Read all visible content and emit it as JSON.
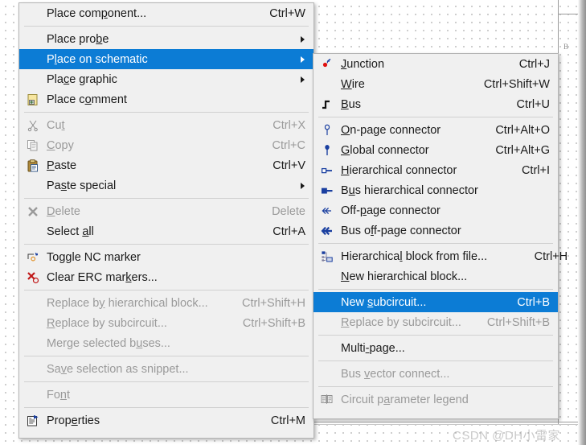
{
  "canvas": {
    "sheet_letter": "B",
    "watermark": "CSDN @DH小雷家"
  },
  "main_menu": {
    "items": [
      {
        "id": "place-component",
        "label": "Place component...",
        "accel": "Ctrl+W",
        "icon": null,
        "arrow": false,
        "disabled": false,
        "selected": false
      },
      {
        "id": "sep1",
        "separator": true
      },
      {
        "id": "place-probe",
        "label": "Place probe",
        "accel": "",
        "icon": null,
        "arrow": true,
        "disabled": false,
        "selected": false
      },
      {
        "id": "place-on-schematic",
        "label": "Place on schematic",
        "accel": "",
        "icon": null,
        "arrow": true,
        "disabled": false,
        "selected": true
      },
      {
        "id": "place-graphic",
        "label": "Place graphic",
        "accel": "",
        "icon": null,
        "arrow": true,
        "disabled": false,
        "selected": false
      },
      {
        "id": "place-comment",
        "label": "Place comment",
        "accel": "",
        "icon": "comment-icon",
        "arrow": false,
        "disabled": false,
        "selected": false
      },
      {
        "id": "sep2",
        "separator": true
      },
      {
        "id": "cut",
        "label": "Cut",
        "accel": "Ctrl+X",
        "icon": "scissors-icon",
        "arrow": false,
        "disabled": true,
        "selected": false
      },
      {
        "id": "copy",
        "label": "Copy",
        "accel": "Ctrl+C",
        "icon": "copy-icon",
        "arrow": false,
        "disabled": true,
        "selected": false
      },
      {
        "id": "paste",
        "label": "Paste",
        "accel": "Ctrl+V",
        "icon": "clipboard-icon",
        "arrow": false,
        "disabled": false,
        "selected": false
      },
      {
        "id": "paste-special",
        "label": "Paste special",
        "accel": "",
        "icon": null,
        "arrow": true,
        "disabled": false,
        "selected": false
      },
      {
        "id": "sep3",
        "separator": true
      },
      {
        "id": "delete",
        "label": "Delete",
        "accel": "Delete",
        "icon": "x-icon",
        "arrow": false,
        "disabled": true,
        "selected": false
      },
      {
        "id": "select-all",
        "label": "Select all",
        "accel": "Ctrl+A",
        "icon": null,
        "arrow": false,
        "disabled": false,
        "selected": false
      },
      {
        "id": "sep4",
        "separator": true
      },
      {
        "id": "toggle-nc-marker",
        "label": "Toggle NC marker",
        "accel": "",
        "icon": "nc-marker-icon",
        "arrow": false,
        "disabled": false,
        "selected": false
      },
      {
        "id": "clear-erc-markers",
        "label": "Clear ERC markers...",
        "accel": "",
        "icon": "erc-marker-icon",
        "arrow": false,
        "disabled": false,
        "selected": false
      },
      {
        "id": "sep5",
        "separator": true
      },
      {
        "id": "replace-by-hierarchical-block",
        "label": "Replace by hierarchical block...",
        "accel": "Ctrl+Shift+H",
        "icon": null,
        "arrow": false,
        "disabled": true,
        "selected": false
      },
      {
        "id": "replace-by-subcircuit",
        "label": "Replace by subcircuit...",
        "accel": "Ctrl+Shift+B",
        "icon": null,
        "arrow": false,
        "disabled": true,
        "selected": false
      },
      {
        "id": "merge-selected-buses",
        "label": "Merge selected buses...",
        "accel": "",
        "icon": null,
        "arrow": false,
        "disabled": true,
        "selected": false
      },
      {
        "id": "sep6",
        "separator": true
      },
      {
        "id": "save-selection-as-snippet",
        "label": "Save selection as snippet...",
        "accel": "",
        "icon": null,
        "arrow": false,
        "disabled": true,
        "selected": false
      },
      {
        "id": "sep7",
        "separator": true
      },
      {
        "id": "font",
        "label": "Font",
        "accel": "",
        "icon": null,
        "arrow": false,
        "disabled": true,
        "selected": false
      },
      {
        "id": "sep8",
        "separator": true
      },
      {
        "id": "properties",
        "label": "Properties",
        "accel": "Ctrl+M",
        "icon": "properties-icon",
        "arrow": false,
        "disabled": false,
        "selected": false
      }
    ]
  },
  "sub_menu": {
    "items": [
      {
        "id": "junction",
        "label": "Junction",
        "accel": "Ctrl+J",
        "icon": "junction-icon",
        "disabled": false,
        "selected": false
      },
      {
        "id": "wire",
        "label": "Wire",
        "accel": "Ctrl+Shift+W",
        "icon": null,
        "disabled": false,
        "selected": false
      },
      {
        "id": "bus",
        "label": "Bus",
        "accel": "Ctrl+U",
        "icon": "bus-icon",
        "disabled": false,
        "selected": false
      },
      {
        "id": "sep1",
        "separator": true
      },
      {
        "id": "on-page-connector",
        "label": "On-page connector",
        "accel": "Ctrl+Alt+O",
        "icon": "on-page-connector-icon",
        "disabled": false,
        "selected": false
      },
      {
        "id": "global-connector",
        "label": "Global connector",
        "accel": "Ctrl+Alt+G",
        "icon": "global-connector-icon",
        "disabled": false,
        "selected": false
      },
      {
        "id": "hierarchical-connector",
        "label": "Hierarchical connector",
        "accel": "Ctrl+I",
        "icon": "hierarchical-connector-icon",
        "disabled": false,
        "selected": false
      },
      {
        "id": "bus-hierarchical-connector",
        "label": "Bus hierarchical connector",
        "accel": "",
        "icon": "bus-hierarchical-connector-icon",
        "disabled": false,
        "selected": false
      },
      {
        "id": "off-page-connector",
        "label": "Off-page connector",
        "accel": "",
        "icon": "off-page-connector-icon",
        "disabled": false,
        "selected": false
      },
      {
        "id": "bus-off-page-connector",
        "label": "Bus off-page connector",
        "accel": "",
        "icon": "bus-off-page-connector-icon",
        "disabled": false,
        "selected": false
      },
      {
        "id": "sep2",
        "separator": true
      },
      {
        "id": "hierarchical-block-from-file",
        "label": "Hierarchical block from file...",
        "accel": "Ctrl+H",
        "icon": "hierarchical-block-icon",
        "disabled": false,
        "selected": false
      },
      {
        "id": "new-hierarchical-block",
        "label": "New hierarchical block...",
        "accel": "",
        "icon": null,
        "disabled": false,
        "selected": false
      },
      {
        "id": "sep3",
        "separator": true
      },
      {
        "id": "new-subcircuit",
        "label": "New subcircuit...",
        "accel": "Ctrl+B",
        "icon": null,
        "disabled": false,
        "selected": true
      },
      {
        "id": "replace-by-subcircuit",
        "label": "Replace by subcircuit...",
        "accel": "Ctrl+Shift+B",
        "icon": null,
        "disabled": true,
        "selected": false
      },
      {
        "id": "sep4",
        "separator": true
      },
      {
        "id": "multi-page",
        "label": "Multi-page...",
        "accel": "",
        "icon": null,
        "disabled": false,
        "selected": false
      },
      {
        "id": "sep5",
        "separator": true
      },
      {
        "id": "bus-vector-connect",
        "label": "Bus vector connect...",
        "accel": "",
        "icon": null,
        "disabled": true,
        "selected": false
      },
      {
        "id": "sep6",
        "separator": true
      },
      {
        "id": "circuit-parameter-legend",
        "label": "Circuit parameter legend",
        "accel": "",
        "icon": "circuit-legend-icon",
        "disabled": true,
        "selected": false
      }
    ]
  },
  "colors": {
    "highlight": "#0c7cd5",
    "menu_background": "#f0f0f0",
    "menu_border": "#b4b4b4",
    "disabled_text": "#9a9a9a",
    "text": "#1a1a1a"
  }
}
